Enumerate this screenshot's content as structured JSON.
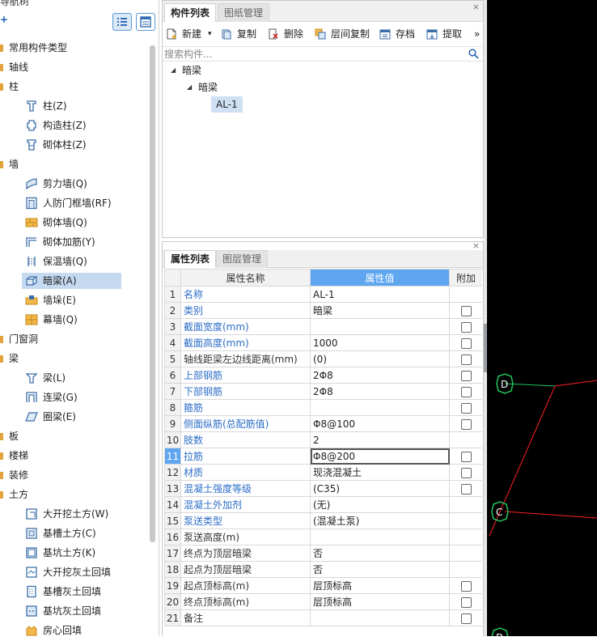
{
  "nav": {
    "title": "导航树",
    "add_glyph": "+",
    "categories": [
      {
        "label": "常用构件类型"
      },
      {
        "label": "轴线"
      },
      {
        "label": "柱"
      },
      {
        "label": "墙"
      },
      {
        "label": "门窗洞"
      },
      {
        "label": "梁"
      },
      {
        "label": "板"
      },
      {
        "label": "楼梯"
      },
      {
        "label": "装修"
      },
      {
        "label": "土方"
      }
    ],
    "items": [
      {
        "label": "柱(Z)",
        "icon": "column-icon"
      },
      {
        "label": "构造柱(Z)",
        "icon": "construct-column-icon"
      },
      {
        "label": "砌体柱(Z)",
        "icon": "masonry-column-icon"
      },
      {
        "label": "剪力墙(Q)",
        "icon": "shear-wall-icon"
      },
      {
        "label": "人防门框墙(RF)",
        "icon": "civil-defense-door-wall-icon"
      },
      {
        "label": "砌体墙(Q)",
        "icon": "masonry-wall-icon"
      },
      {
        "label": "砌体加筋(Y)",
        "icon": "masonry-reinforcement-icon"
      },
      {
        "label": "保温墙(Q)",
        "icon": "insulation-wall-icon"
      },
      {
        "label": "暗梁(A)",
        "icon": "hidden-beam-icon",
        "selected": true
      },
      {
        "label": "墙垛(E)",
        "icon": "wall-pier-icon"
      },
      {
        "label": "幕墙(Q)",
        "icon": "curtain-wall-icon"
      },
      {
        "label": "梁(L)",
        "icon": "beam-icon"
      },
      {
        "label": "连梁(G)",
        "icon": "coupling-beam-icon"
      },
      {
        "label": "圈梁(E)",
        "icon": "ring-beam-icon"
      },
      {
        "label": "大开挖土方(W)",
        "icon": "excavation-icon"
      },
      {
        "label": "基槽土方(C)",
        "icon": "trench-earthwork-icon"
      },
      {
        "label": "基坑土方(K)",
        "icon": "pit-earthwork-icon"
      },
      {
        "label": "大开挖灰土回填",
        "icon": "excavation-backfill-icon"
      },
      {
        "label": "基槽灰土回填",
        "icon": "trench-backfill-icon"
      },
      {
        "label": "基坑灰土回填",
        "icon": "pit-backfill-icon"
      },
      {
        "label": "房心回填",
        "icon": "room-backfill-icon"
      }
    ]
  },
  "component_panel": {
    "tabs": [
      {
        "label": "构件列表",
        "active": true
      },
      {
        "label": "图纸管理",
        "active": false
      }
    ],
    "close_glyph": "×",
    "toolbar": [
      {
        "label": "新建",
        "icon": "new-icon",
        "dropdown": "▾"
      },
      {
        "label": "复制",
        "icon": "copy-icon"
      },
      {
        "label": "删除",
        "icon": "delete-icon"
      },
      {
        "label": "层间复制",
        "icon": "floor-copy-icon"
      },
      {
        "label": "存档",
        "icon": "archive-icon"
      },
      {
        "label": "提取",
        "icon": "extract-icon"
      }
    ],
    "toolbar_more": "»",
    "search": {
      "placeholder": "搜索构件..."
    },
    "tree": [
      {
        "label": "暗梁",
        "expanded": true
      },
      {
        "label": "暗梁",
        "expanded": true
      },
      {
        "label": "AL-1",
        "selected": true
      }
    ],
    "tree_glyph": "◢"
  },
  "property_panel": {
    "tabs": [
      {
        "label": "属性列表",
        "active": true
      },
      {
        "label": "图层管理",
        "active": false
      }
    ],
    "close_glyph": "×",
    "columns": {
      "name": "属性名称",
      "value": "属性值",
      "extra": "附加"
    },
    "rows": [
      {
        "n": "1",
        "name": "名称",
        "value": "AL-1",
        "blue": true,
        "check": false
      },
      {
        "n": "2",
        "name": "类别",
        "value": "暗梁",
        "blue": true,
        "check": true
      },
      {
        "n": "3",
        "name": "截面宽度(mm)",
        "value": "",
        "blue": true,
        "check": true
      },
      {
        "n": "4",
        "name": "截面高度(mm)",
        "value": "1000",
        "blue": true,
        "check": true
      },
      {
        "n": "5",
        "name": "轴线距梁左边线距离(mm)",
        "value": "(0)",
        "blue": false,
        "check": true
      },
      {
        "n": "6",
        "name": "上部钢筋",
        "value": "2Φ8",
        "blue": true,
        "check": true
      },
      {
        "n": "7",
        "name": "下部钢筋",
        "value": "2Φ8",
        "blue": true,
        "check": true
      },
      {
        "n": "8",
        "name": "箍筋",
        "value": "",
        "blue": true,
        "check": true
      },
      {
        "n": "9",
        "name": "侧面纵筋(总配筋值)",
        "value": "Φ8@100",
        "blue": true,
        "check": true
      },
      {
        "n": "10",
        "name": "肢数",
        "value": "2",
        "blue": true,
        "check": false
      },
      {
        "n": "11",
        "name": "拉筋",
        "value": "Φ8@200",
        "blue": true,
        "check": true,
        "selected": true
      },
      {
        "n": "12",
        "name": "材质",
        "value": "现浇混凝土",
        "blue": true,
        "check": true
      },
      {
        "n": "13",
        "name": "混凝土强度等级",
        "value": "(C35)",
        "blue": true,
        "check": true
      },
      {
        "n": "14",
        "name": "混凝土外加剂",
        "value": "(无)",
        "blue": true,
        "check": false
      },
      {
        "n": "15",
        "name": "泵送类型",
        "value": "(混凝土泵)",
        "blue": true,
        "check": false
      },
      {
        "n": "16",
        "name": "泵送高度(m)",
        "value": "",
        "blue": false,
        "check": false
      },
      {
        "n": "17",
        "name": "终点为顶层暗梁",
        "value": "否",
        "blue": false,
        "check": false
      },
      {
        "n": "18",
        "name": "起点为顶层暗梁",
        "value": "否",
        "blue": false,
        "check": false
      },
      {
        "n": "19",
        "name": "起点顶标高(m)",
        "value": "层顶标高",
        "blue": false,
        "check": true
      },
      {
        "n": "20",
        "name": "终点顶标高(m)",
        "value": "层顶标高",
        "blue": false,
        "check": true
      },
      {
        "n": "21",
        "name": "备注",
        "value": "",
        "blue": false,
        "check": true
      }
    ]
  },
  "canvas": {
    "axis_labels": [
      "D",
      "C",
      "D"
    ],
    "colors": {
      "background": "#000000",
      "axis_circle": "#22c55e",
      "grid_line": "#ff2020",
      "green_line": "#22c55e"
    }
  }
}
